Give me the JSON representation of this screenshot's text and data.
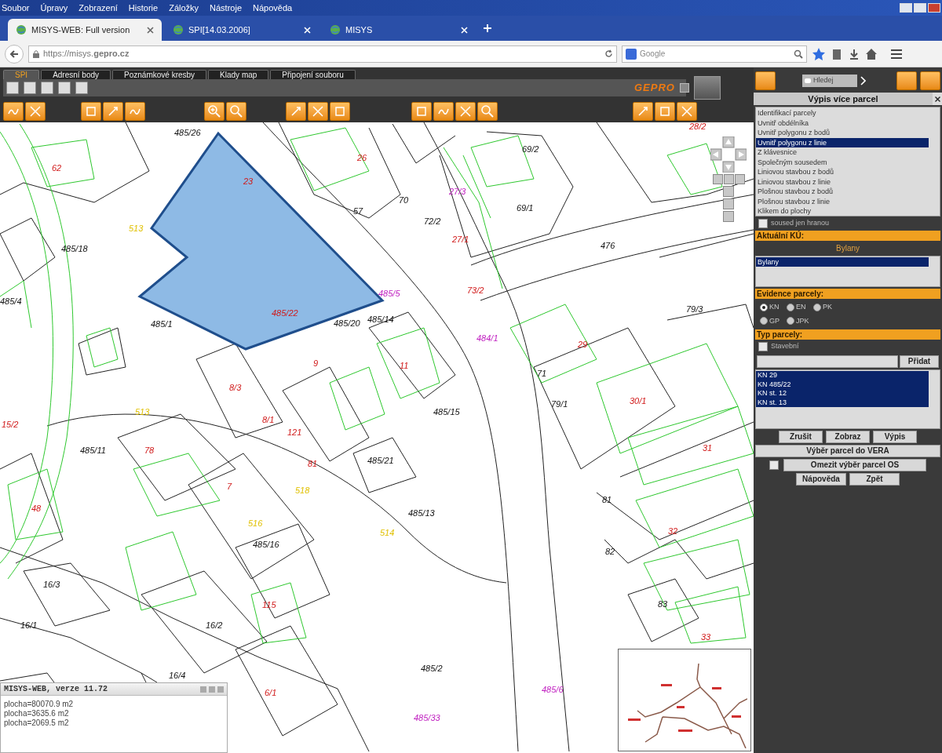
{
  "browser": {
    "menu": [
      "Soubor",
      "Úpravy",
      "Zobrazení",
      "Historie",
      "Záložky",
      "Nástroje",
      "Nápověda"
    ],
    "tabs": [
      {
        "title": "MISYS-WEB: Full version",
        "selected": true
      },
      {
        "title": "SPI[14.03.2006]",
        "selected": false
      },
      {
        "title": "MISYS",
        "selected": false
      }
    ],
    "url": "https://misys.**gepro.cz**",
    "search_placeholder": "Google"
  },
  "app": {
    "tabs": [
      {
        "label": "SPI",
        "selected": true
      },
      {
        "label": "Adresní body",
        "selected": false
      },
      {
        "label": "Poznámkové kresby",
        "selected": false
      },
      {
        "label": "Klady map",
        "selected": false
      },
      {
        "label": "Připojení souboru",
        "selected": false
      }
    ],
    "logo": "GEPRO"
  },
  "map": {
    "labels": [
      {
        "text": "485/26",
        "kind": "parcel"
      },
      {
        "text": "62",
        "kind": "building"
      },
      {
        "text": "26",
        "kind": "building"
      },
      {
        "text": "69/2",
        "kind": "parcel"
      },
      {
        "text": "28/2",
        "kind": "building"
      },
      {
        "text": "23",
        "kind": "building"
      },
      {
        "text": "57",
        "kind": "parcel"
      },
      {
        "text": "70",
        "kind": "parcel"
      },
      {
        "text": "27/3",
        "kind": "road"
      },
      {
        "text": "72/2",
        "kind": "parcel"
      },
      {
        "text": "69/1",
        "kind": "parcel"
      },
      {
        "text": "513",
        "kind": "point"
      },
      {
        "text": "485/18",
        "kind": "parcel"
      },
      {
        "text": "27/1",
        "kind": "building"
      },
      {
        "text": "476",
        "kind": "parcel"
      },
      {
        "text": "485/4",
        "kind": "parcel"
      },
      {
        "text": "485/5",
        "kind": "road"
      },
      {
        "text": "485/22",
        "kind": "building"
      },
      {
        "text": "73/2",
        "kind": "building"
      },
      {
        "text": "79/3",
        "kind": "parcel"
      },
      {
        "text": "485/1",
        "kind": "parcel"
      },
      {
        "text": "485/20",
        "kind": "parcel"
      },
      {
        "text": "485/14",
        "kind": "parcel"
      },
      {
        "text": "484/1",
        "kind": "road"
      },
      {
        "text": "29",
        "kind": "building"
      },
      {
        "text": "9",
        "kind": "building"
      },
      {
        "text": "11",
        "kind": "building"
      },
      {
        "text": "71",
        "kind": "parcel"
      },
      {
        "text": "79/1",
        "kind": "parcel"
      },
      {
        "text": "30/1",
        "kind": "building"
      },
      {
        "text": "8/3",
        "kind": "building"
      },
      {
        "text": "8/1",
        "kind": "building"
      },
      {
        "text": "513",
        "kind": "point"
      },
      {
        "text": "485/15",
        "kind": "parcel"
      },
      {
        "text": "15/2",
        "kind": "building"
      },
      {
        "text": "485/11",
        "kind": "parcel"
      },
      {
        "text": "78",
        "kind": "building"
      },
      {
        "text": "121",
        "kind": "building"
      },
      {
        "text": "31",
        "kind": "building"
      },
      {
        "text": "485/21",
        "kind": "parcel"
      },
      {
        "text": "81",
        "kind": "building"
      },
      {
        "text": "7",
        "kind": "building"
      },
      {
        "text": "81",
        "kind": "parcel"
      },
      {
        "text": "48",
        "kind": "building"
      },
      {
        "text": "518",
        "kind": "point"
      },
      {
        "text": "485/13",
        "kind": "parcel"
      },
      {
        "text": "32",
        "kind": "building"
      },
      {
        "text": "516",
        "kind": "point"
      },
      {
        "text": "514",
        "kind": "point"
      },
      {
        "text": "485/16",
        "kind": "parcel"
      },
      {
        "text": "82",
        "kind": "parcel"
      },
      {
        "text": "16/3",
        "kind": "parcel"
      },
      {
        "text": "115",
        "kind": "building"
      },
      {
        "text": "83",
        "kind": "parcel"
      },
      {
        "text": "16/1",
        "kind": "parcel"
      },
      {
        "text": "16/2",
        "kind": "parcel"
      },
      {
        "text": "33",
        "kind": "building"
      },
      {
        "text": "485/2",
        "kind": "parcel"
      },
      {
        "text": "16/4",
        "kind": "parcel"
      },
      {
        "text": "6/1",
        "kind": "building"
      },
      {
        "text": "485/6",
        "kind": "road"
      },
      {
        "text": "485/33",
        "kind": "road"
      }
    ]
  },
  "output_window": {
    "title": "MISYS-WEB, verze 11.72",
    "lines": [
      "plocha=80070.9 m2",
      "plocha=3635.6 m2",
      "plocha=2069.5 m2"
    ]
  },
  "panel": {
    "search_placeholder": "Hledej",
    "title": "Výpis více parcel",
    "methods": [
      {
        "label": "Identifikací parcely",
        "selected": false
      },
      {
        "label": "Uvnitř obdélníka",
        "selected": false
      },
      {
        "label": "Uvnitř polygonu z bodů",
        "selected": false
      },
      {
        "label": "Uvnitř polygonu z linie",
        "selected": true
      },
      {
        "label": "Z klávesnice",
        "selected": false
      },
      {
        "label": "Společným sousedem",
        "selected": false
      },
      {
        "label": "Liniovou stavbou z bodů",
        "selected": false
      },
      {
        "label": "Liniovou stavbou z linie",
        "selected": false
      },
      {
        "label": "Plošnou stavbou z bodů",
        "selected": false
      },
      {
        "label": "Plošnou stavbou z linie",
        "selected": false
      },
      {
        "label": "Klikem do plochy",
        "selected": false
      }
    ],
    "neighbors_only": {
      "label": "soused jen hranou",
      "checked": false
    },
    "cadastre_header": "Aktuální KÚ:",
    "cadastre_name": "Bylany",
    "cadastre_list": [
      {
        "label": "Bylany",
        "selected": true
      }
    ],
    "evidence_header": "Evidence parcely:",
    "evidence": [
      {
        "label": "KN",
        "selected": true
      },
      {
        "label": "EN",
        "selected": false
      },
      {
        "label": "PK",
        "selected": false
      },
      {
        "label": "GP",
        "selected": false
      },
      {
        "label": "JPK",
        "selected": false
      }
    ],
    "type_header": "Typ parcely:",
    "building": {
      "label": "Stavební",
      "checked": false
    },
    "add_button": "Přidat",
    "parcels": [
      {
        "label": "KN 29",
        "selected": true
      },
      {
        "label": "KN 485/22",
        "selected": true
      },
      {
        "label": "KN st. 12",
        "selected": true
      },
      {
        "label": "KN st. 13",
        "selected": true
      }
    ],
    "actions": [
      "Zrušit",
      "Zobraz",
      "Výpis"
    ],
    "vera_button": "Výběr parcel do VERA",
    "limit": {
      "label": "Omezit výběr parcel OS",
      "checked": false
    },
    "help_button": "Nápověda",
    "back_button": "Zpět"
  }
}
